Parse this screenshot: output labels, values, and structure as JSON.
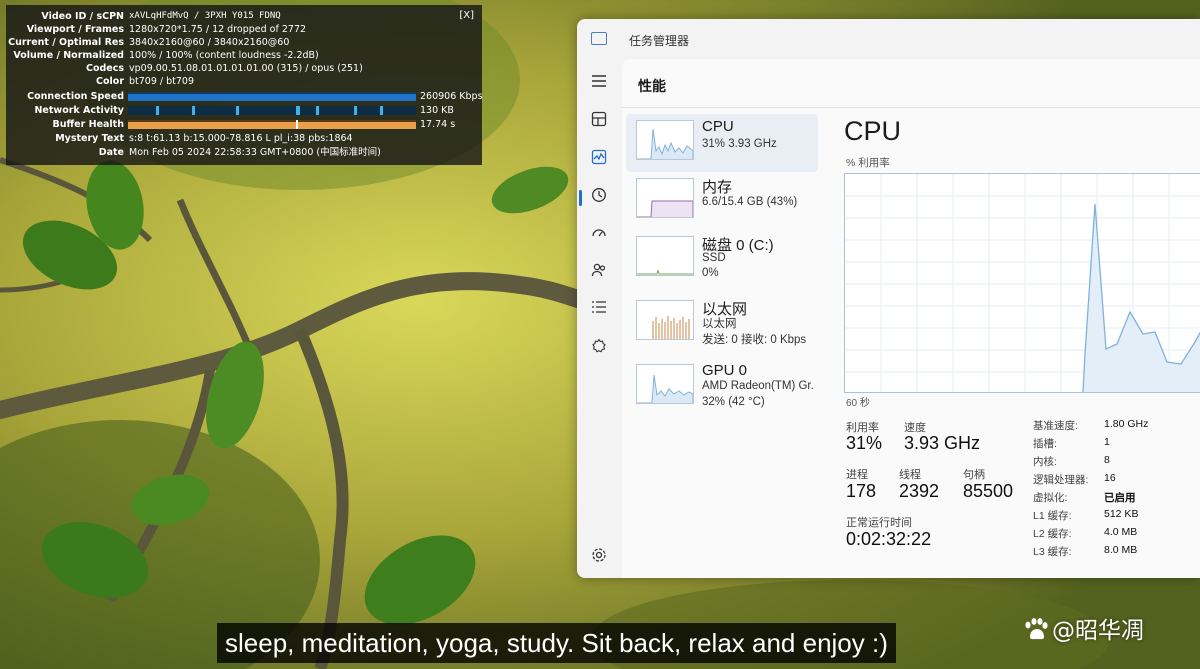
{
  "stats": {
    "close": "[X]",
    "rows": [
      {
        "label": "Video ID / sCPN",
        "value": "xAVLqHFdMvQ  /  3PXH  Y015  FDNQ"
      },
      {
        "label": "Viewport / Frames",
        "value": "1280x720*1.75 / 12 dropped of 2772"
      },
      {
        "label": "Current / Optimal Res",
        "value": "3840x2160@60 / 3840x2160@60"
      },
      {
        "label": "Volume / Normalized",
        "value": "100% / 100% (content loudness -2.2dB)"
      },
      {
        "label": "Codecs",
        "value": "vp09.00.51.08.01.01.01.01.00 (315) / opus (251)"
      },
      {
        "label": "Color",
        "value": "bt709 / bt709"
      },
      {
        "label": "Connection Speed",
        "value": "260906 Kbps"
      },
      {
        "label": "Network Activity",
        "value": "130 KB"
      },
      {
        "label": "Buffer Health",
        "value": "17.74 s"
      },
      {
        "label": "Mystery Text",
        "value": "s:8 t:61.13 b:15.000-78.816 L pl_i:38 pbs:1864"
      },
      {
        "label": "Date",
        "value": "Mon Feb 05 2024 22:58:33 GMT+0800 (中国标准时间)"
      }
    ]
  },
  "taskmanager": {
    "title": "任务管理器",
    "page_title": "性能",
    "nav_icons": [
      "menu-icon",
      "processes-icon",
      "performance-icon",
      "app-history-icon",
      "startup-icon",
      "users-icon",
      "details-icon",
      "services-icon",
      "settings-icon"
    ],
    "resources": [
      {
        "name": "CPU",
        "line1": "31% 3.93 GHz",
        "line2": ""
      },
      {
        "name": "内存",
        "line1": "6.6/15.4 GB (43%)",
        "line2": ""
      },
      {
        "name": "磁盘 0 (C:)",
        "line1": "SSD",
        "line2": "0%"
      },
      {
        "name": "以太网",
        "line1": "以太网",
        "line2": "发送: 0 接收: 0 Kbps"
      },
      {
        "name": "GPU 0",
        "line1": "AMD Radeon(TM) Gr.",
        "line2": "32% (42 °C)"
      }
    ],
    "cpu": {
      "header": "CPU",
      "util_label": "% 利用率",
      "time_label": "60 秒",
      "utilization_label": "利用率",
      "utilization": "31%",
      "speed_label": "速度",
      "speed": "3.93 GHz",
      "processes_label": "进程",
      "processes": "178",
      "threads_label": "线程",
      "threads": "2392",
      "handles_label": "句柄",
      "handles": "85500",
      "uptime_label": "正常运行时间",
      "uptime": "0:02:32:22",
      "specs": [
        {
          "label": "基准速度:",
          "value": "1.80 GHz"
        },
        {
          "label": "插槽:",
          "value": "1"
        },
        {
          "label": "内核:",
          "value": "8"
        },
        {
          "label": "逻辑处理器:",
          "value": "16"
        },
        {
          "label": "虚拟化:",
          "value": "已启用"
        },
        {
          "label": "L1 缓存:",
          "value": "512 KB"
        },
        {
          "label": "L2 缓存:",
          "value": "4.0 MB"
        },
        {
          "label": "L3 缓存:",
          "value": "8.0 MB"
        }
      ]
    }
  },
  "subtitle": "sleep, meditation, yoga, study. Sit back, relax and enjoy :)",
  "watermark": "@昭华凋",
  "colors": {
    "accent": "#1f6fd1",
    "cpu_line": "#7fb2de",
    "net_line": "#c9844a",
    "mem_line": "#9b6bb0"
  }
}
